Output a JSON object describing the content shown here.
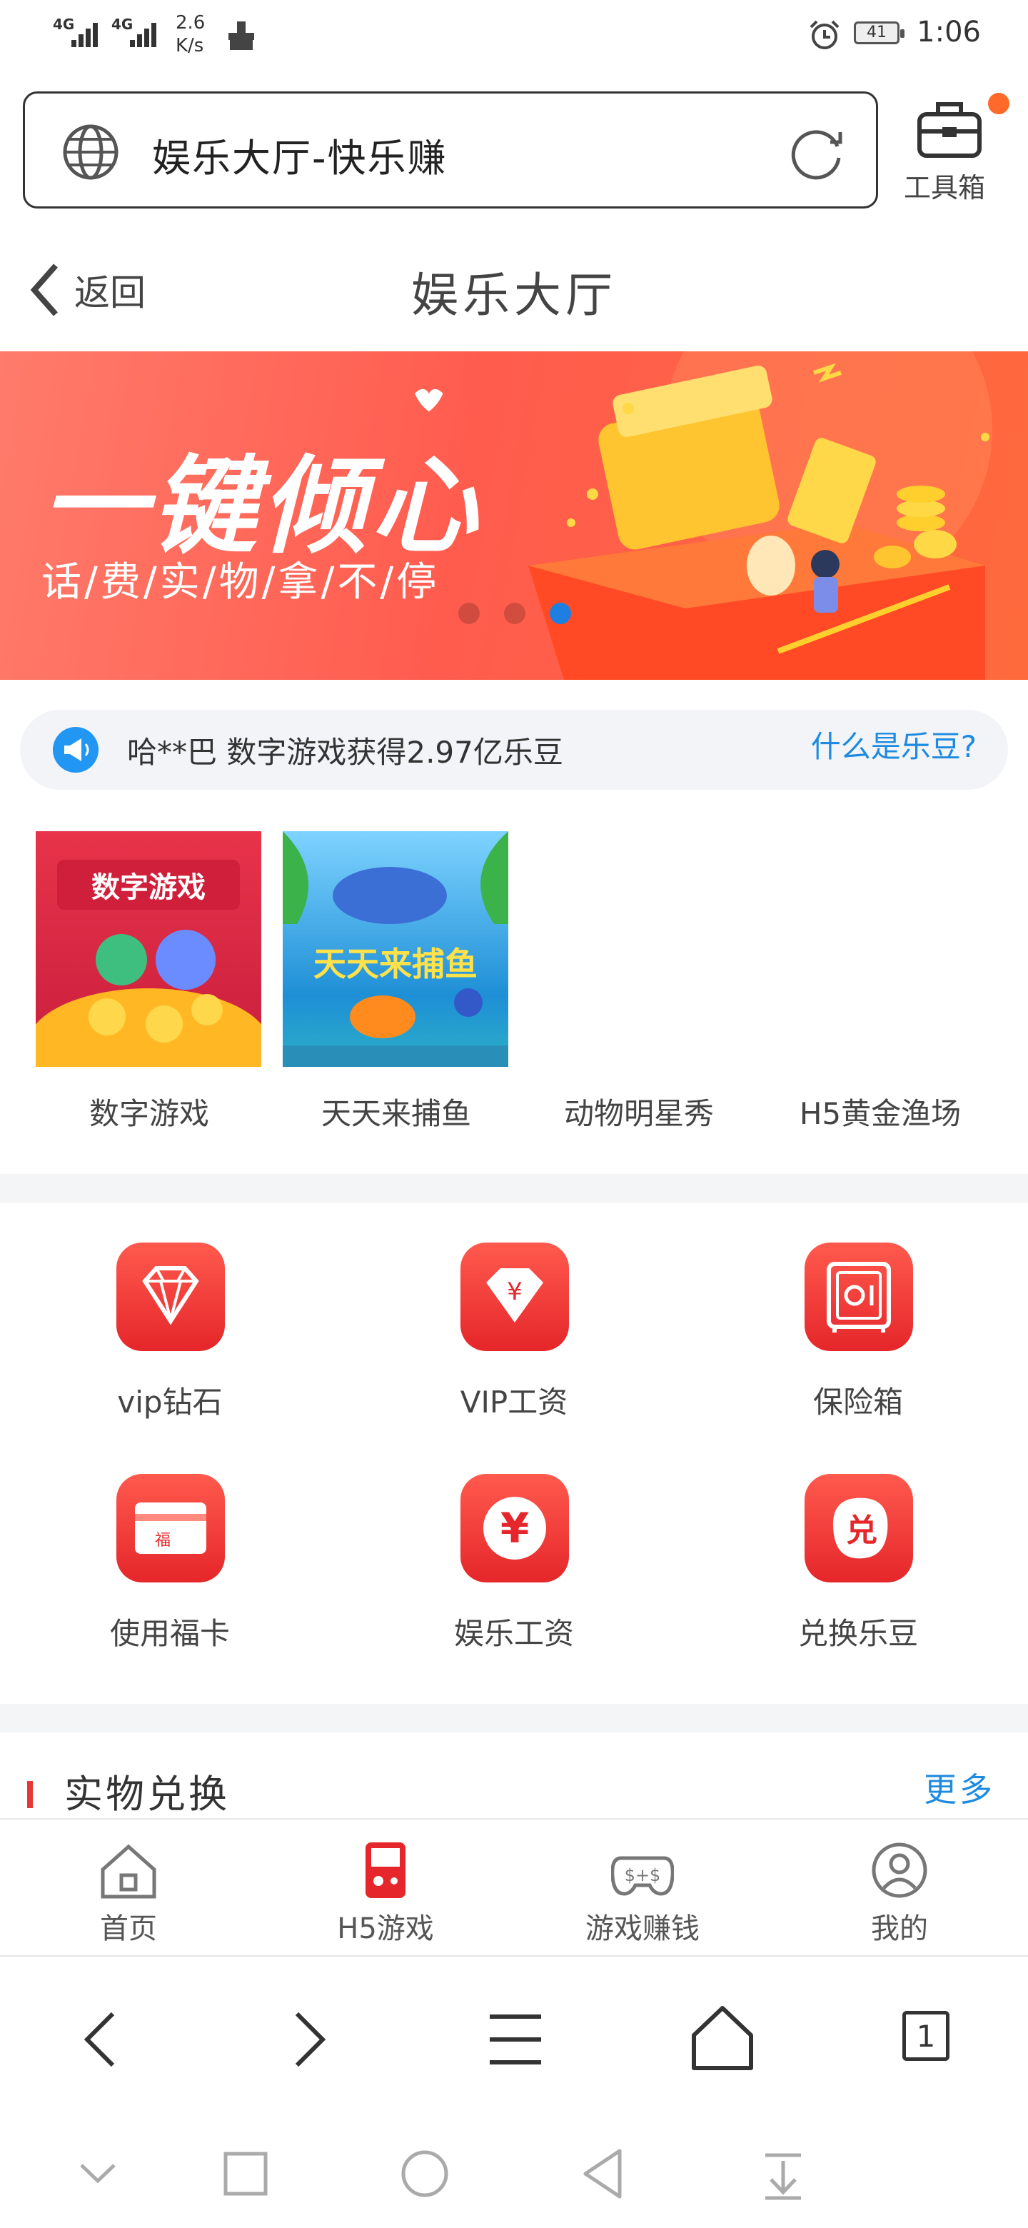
{
  "status_bar": {
    "signal1": "4G",
    "signal2": "4G",
    "net_speed_value": "2.6",
    "net_speed_unit": "K/s",
    "battery": "41",
    "time": "1:06"
  },
  "url_bar": {
    "page_title": "娱乐大厅-快乐赚",
    "toolbox_label": "工具箱"
  },
  "header": {
    "back_label": "返回",
    "title": "娱乐大厅"
  },
  "banner": {
    "headline": "一键倾心",
    "subline": "话/费/实/物/拿/不/停",
    "active_index": 2
  },
  "notice": {
    "text": "哈**巴 数字游戏获得2.97亿乐豆",
    "link": "什么是乐豆?"
  },
  "games": [
    {
      "name": "数字游戏",
      "thumb_text": "数字游戏"
    },
    {
      "name": "天天来捕鱼",
      "thumb_text": "天天来捕鱼"
    },
    {
      "name": "动物明星秀"
    },
    {
      "name": "H5黄金渔场"
    }
  ],
  "features": [
    {
      "label": "vip钻石",
      "icon": "diamond-icon"
    },
    {
      "label": "VIP工资",
      "icon": "yen-gem-icon"
    },
    {
      "label": "保险箱",
      "icon": "safe-icon"
    },
    {
      "label": "使用福卡",
      "icon": "card-icon",
      "icon_text": "福"
    },
    {
      "label": "娱乐工资",
      "icon": "yen-circle-icon",
      "icon_text": "¥"
    },
    {
      "label": "兑换乐豆",
      "icon": "exchange-icon",
      "icon_text": "兑"
    }
  ],
  "section": {
    "title": "实物兑换",
    "more": "更多"
  },
  "tabs": [
    {
      "label": "首页",
      "icon": "home-icon"
    },
    {
      "label": "H5游戏",
      "icon": "gameboy-icon"
    },
    {
      "label": "游戏赚钱",
      "icon": "gamepad-icon"
    },
    {
      "label": "我的",
      "icon": "user-icon"
    }
  ],
  "browser_nav": {
    "tab_count": "1"
  },
  "colors": {
    "accent_red": "#e5262a",
    "link_blue": "#1e8be0",
    "banner": "#ff5c4e"
  }
}
